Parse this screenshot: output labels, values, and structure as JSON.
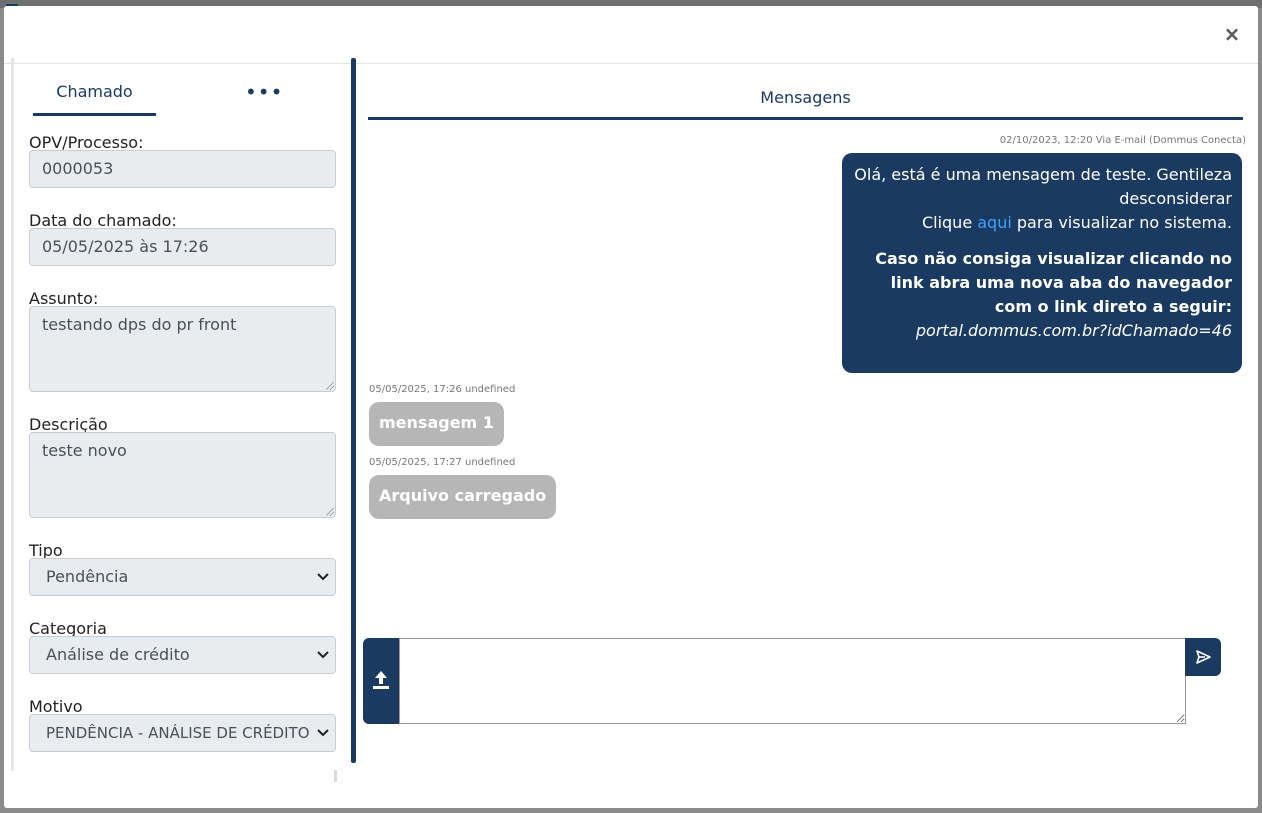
{
  "modal": {
    "close_label": "×"
  },
  "left": {
    "tabs": [
      {
        "label": "Chamado"
      },
      {
        "label": "•••"
      }
    ],
    "fields": {
      "opv_label": "OPV/Processo:",
      "opv_value": "0000053",
      "data_label": "Data do chamado:",
      "data_value": "05/05/2025 às  17:26",
      "assunto_label": "Assunto:",
      "assunto_value": "testando dps do pr front",
      "descricao_label": "Descrição",
      "descricao_value": "teste novo",
      "tipo_label": "Tipo",
      "tipo_value": "Pendência",
      "categoria_label": "Categoria",
      "categoria_value": "Análise de crédito",
      "motivo_label": "Motivo",
      "motivo_value": "PENDÊNCIA - ANÁLISE DE CRÉDITO"
    }
  },
  "right": {
    "title": "Mensagens",
    "messages": [
      {
        "meta": "02/10/2023, 12:20 Via E-mail (Dommus Conecta)",
        "line1": "Olá, está é uma mensagem de teste. Gentileza desconsiderar",
        "click_pre": "Clique ",
        "click_link": "aqui",
        "click_post": " para visualizar no sistema.",
        "bold_text": "Caso não consiga visualizar clicando no link abra uma nova aba do navegador com o link direto a seguir: ",
        "url_text": "portal.dommus.com.br?idChamado=46"
      },
      {
        "meta": "05/05/2025, 17:26 undefined",
        "text": "mensagem 1"
      },
      {
        "meta": "05/05/2025, 17:27 undefined",
        "text": "Arquivo carregado"
      }
    ],
    "composer": {
      "placeholder": ""
    }
  },
  "colors": {
    "primary": "#1b3a61",
    "link": "#3ea0ff",
    "bubble_in": "#b6b6b6"
  },
  "icons": {
    "close": "close-icon",
    "upload": "upload-icon",
    "send": "send-icon"
  }
}
